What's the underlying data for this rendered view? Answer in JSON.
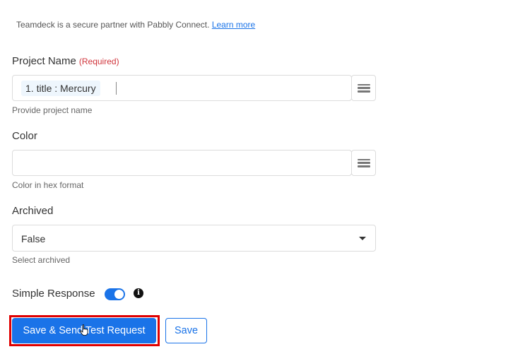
{
  "partner_note": {
    "text": "Teamdeck is a secure partner with Pabbly Connect.",
    "link": "Learn more"
  },
  "project_name": {
    "label": "Project Name",
    "required": "(Required)",
    "chip": "1. title : Mercury",
    "help": "Provide project name",
    "menu_icon": "hamburger-menu-icon"
  },
  "color": {
    "label": "Color",
    "value": "",
    "help": "Color in hex format",
    "menu_icon": "hamburger-menu-icon"
  },
  "archived": {
    "label": "Archived",
    "selected": "False",
    "help": "Select archived"
  },
  "simple_response": {
    "label": "Simple Response",
    "enabled": true,
    "info_icon": "i"
  },
  "buttons": {
    "save_send": "Save & Send Test Request",
    "save": "Save"
  },
  "colors": {
    "accent": "#1a73e8",
    "required": "#d0343b",
    "highlight": "#e00000"
  }
}
